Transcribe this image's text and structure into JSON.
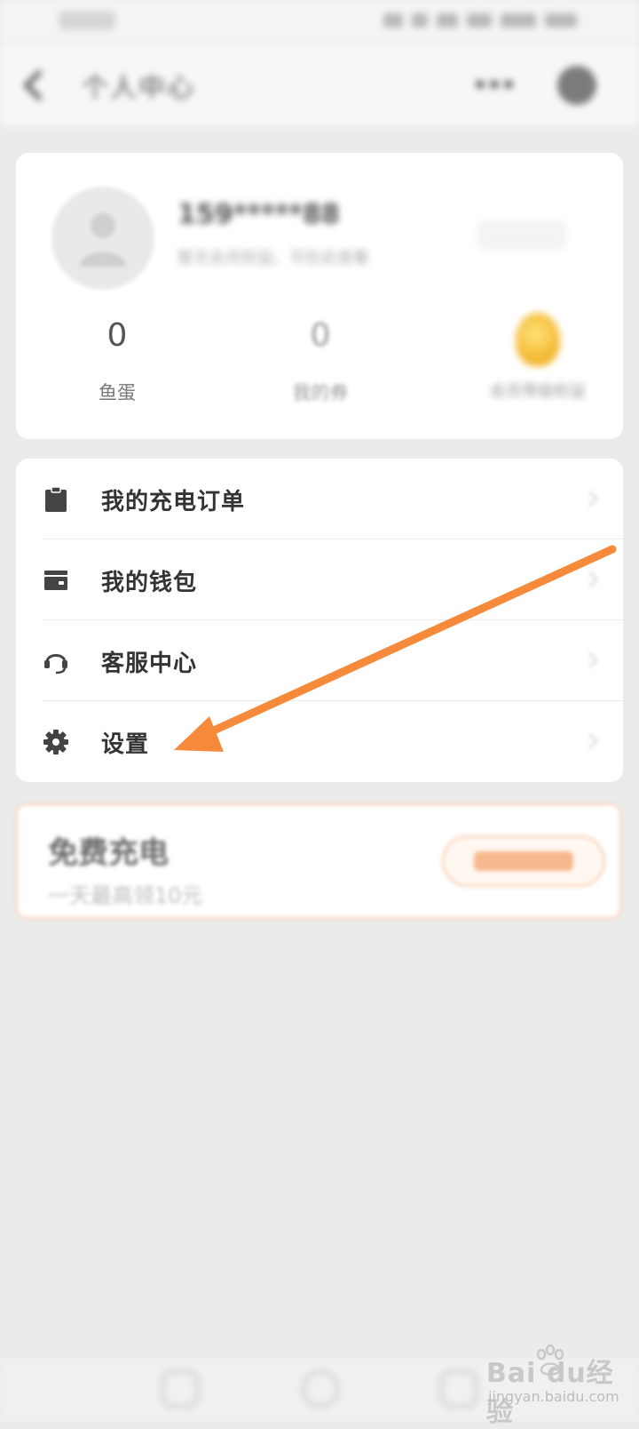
{
  "header": {
    "title": "个人中心"
  },
  "profile": {
    "name": "159*****88",
    "description": "暂无会员权益，可在此查看"
  },
  "stats": [
    {
      "value": "0",
      "label": "鱼蛋"
    },
    {
      "value": "0",
      "label": "我的券"
    },
    {
      "label": "会员等级权益"
    }
  ],
  "menu": {
    "items": [
      {
        "label": "我的充电订单",
        "icon": "clipboard-icon"
      },
      {
        "label": "我的钱包",
        "icon": "wallet-icon"
      },
      {
        "label": "客服中心",
        "icon": "headset-icon"
      },
      {
        "label": "设置",
        "icon": "gear-icon"
      }
    ]
  },
  "promo": {
    "title": "免费充电",
    "subtitle": "一天最高领10元"
  },
  "watermark": {
    "brand": "Bai  du经验",
    "sub": "jingyan.baidu.com"
  },
  "colors": {
    "accent": "#f58a3b",
    "background": "#ebebeb",
    "card": "#ffffff"
  }
}
